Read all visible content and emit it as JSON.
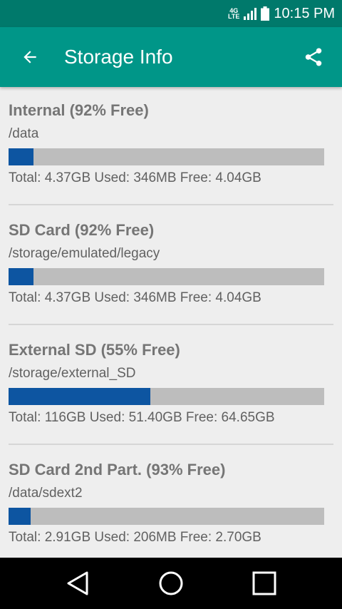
{
  "status_bar": {
    "network_label_top": "4G",
    "network_label_bottom": "LTE",
    "signal_icon": "signal-icon",
    "battery_icon": "battery-icon",
    "time": "10:15 PM"
  },
  "app_bar": {
    "title": "Storage Info",
    "back_icon": "arrow-back-icon",
    "share_icon": "share-icon",
    "background_color": "#009688",
    "status_color": "#00796b"
  },
  "storages": [
    {
      "name": "Internal (92% Free)",
      "path": "/data",
      "used_percent": 8,
      "summary": "Total: 4.37GB Used: 346MB Free: 4.04GB"
    },
    {
      "name": "SD Card (92% Free)",
      "path": "/storage/emulated/legacy",
      "used_percent": 8,
      "summary": "Total: 4.37GB Used: 346MB Free: 4.04GB"
    },
    {
      "name": "External SD (55% Free)",
      "path": "/storage/external_SD",
      "used_percent": 45,
      "summary": "Total: 116GB Used: 51.40GB Free: 64.65GB"
    },
    {
      "name": "SD Card 2nd Part. (93% Free)",
      "path": "/data/sdext2",
      "used_percent": 7,
      "summary": "Total: 2.91GB Used: 206MB Free: 2.70GB"
    }
  ],
  "colors": {
    "bar_used": "#0d55a1",
    "bar_track": "#bdbdbd"
  },
  "nav_bar": {
    "back_icon": "nav-back-icon",
    "home_icon": "nav-home-icon",
    "recents_icon": "nav-recents-icon"
  }
}
